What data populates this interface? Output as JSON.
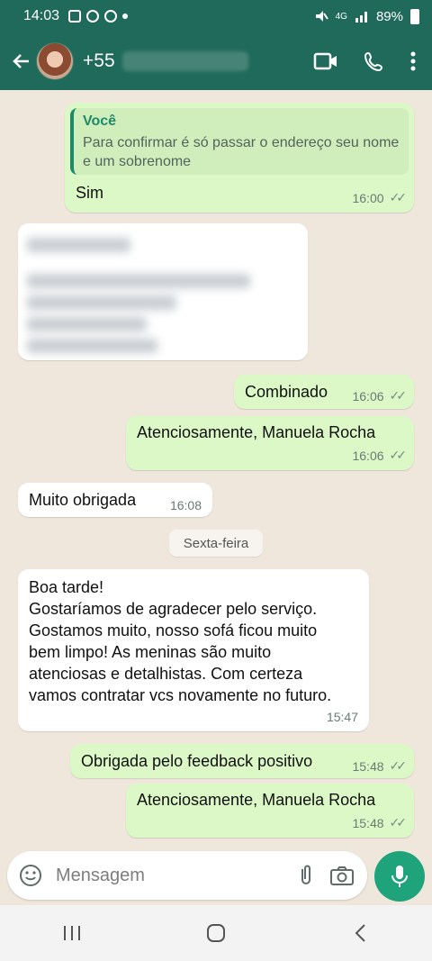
{
  "status_bar": {
    "time": "14:03",
    "network": "4G",
    "battery": "89%"
  },
  "header": {
    "contact_prefix": "+55"
  },
  "messages": [
    {
      "quote_author": "Você",
      "quote_text": "Para confirmar é só passar o endereço seu nome e um sobrenome",
      "text": "Sim",
      "time": "16:00"
    },
    {
      "text": "Combinado",
      "time": "16:06"
    },
    {
      "text": "Atenciosamente, Manuela Rocha",
      "time": "16:06"
    },
    {
      "text": "Muito obrigada",
      "time": "16:08"
    },
    {
      "text": "Boa tarde!\nGostaríamos de agradecer pelo serviço.\nGostamos muito, nosso sofá ficou muito bem limpo! As meninas são muito atenciosas e detalhistas. Com certeza vamos contratar vcs novamente no futuro.",
      "time": "15:47"
    },
    {
      "text": "Obrigada pelo feedback positivo",
      "time": "15:48"
    },
    {
      "text": "Atenciosamente, Manuela Rocha",
      "time": "15:48"
    }
  ],
  "day_separator": "Sexta-feira",
  "composer": {
    "placeholder": "Mensagem"
  },
  "colors": {
    "header": "#1f6a5a",
    "outgoing": "#dcf8c6",
    "incoming": "#ffffff",
    "accent": "#1fa37a"
  },
  "icons": [
    "back-arrow-icon",
    "video-call-icon",
    "phone-icon",
    "more-vert-icon",
    "emoji-icon",
    "attach-icon",
    "camera-icon",
    "mic-icon",
    "double-check-icon"
  ]
}
